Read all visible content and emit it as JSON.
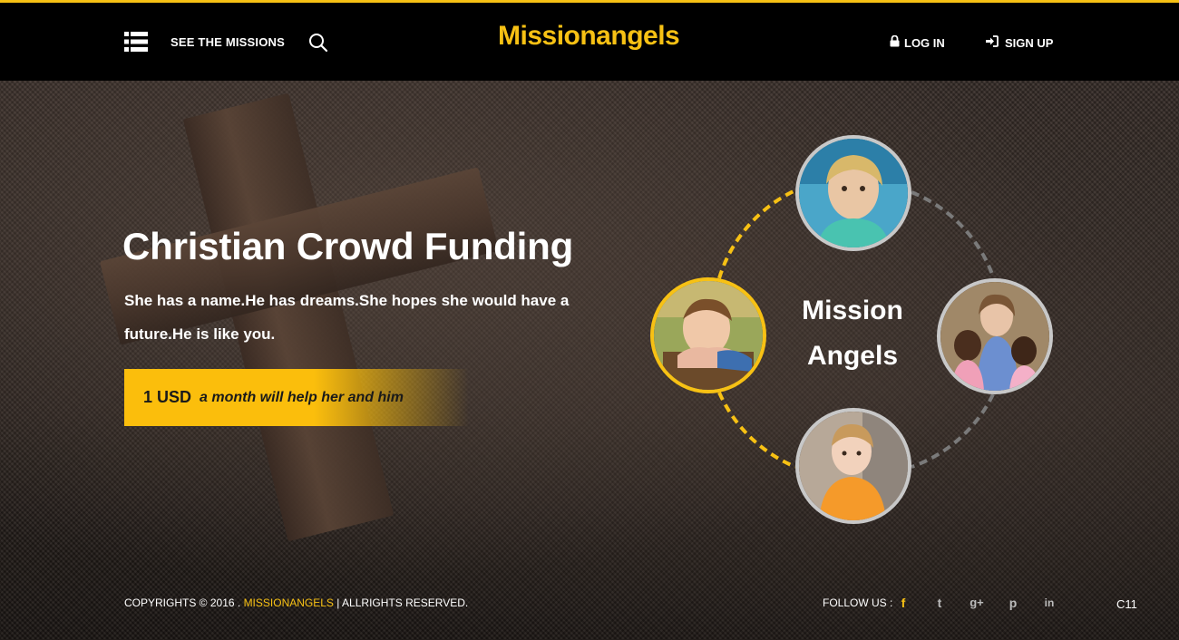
{
  "header": {
    "menu_icon": "list-icon",
    "missions_label": "SEE THE MISSIONS",
    "search_icon": "search-icon",
    "logo": "Missionangels",
    "login_label": "LOG IN",
    "login_icon": "lock-icon",
    "signup_label": "SIGN UP",
    "signup_icon": "sign-in-icon"
  },
  "hero": {
    "title": "Christian Crowd Funding",
    "description": "She has a name.He has dreams.She hopes she would have a future.He is like you.",
    "cta_amount": "1 USD",
    "cta_text": "a month will help her and him"
  },
  "ring": {
    "label_line1": "Mission",
    "label_line2": "Angels",
    "avatars": [
      "child-girl-top",
      "child-boy-left",
      "woman-with-children-right",
      "child-girl-bottom"
    ]
  },
  "footer": {
    "copyright_prefix": "COPYRIGHTS © 2016 .",
    "brand": "MISSIONANGELS",
    "copyright_suffix": "| ALLRIGHTS RESERVED.",
    "follow_label": "FOLLOW US :",
    "social": [
      "f",
      "t",
      "g+",
      "p",
      "in"
    ],
    "corner_code": "C11"
  },
  "colors": {
    "accent": "#f7c114",
    "header_bg": "#000000"
  }
}
